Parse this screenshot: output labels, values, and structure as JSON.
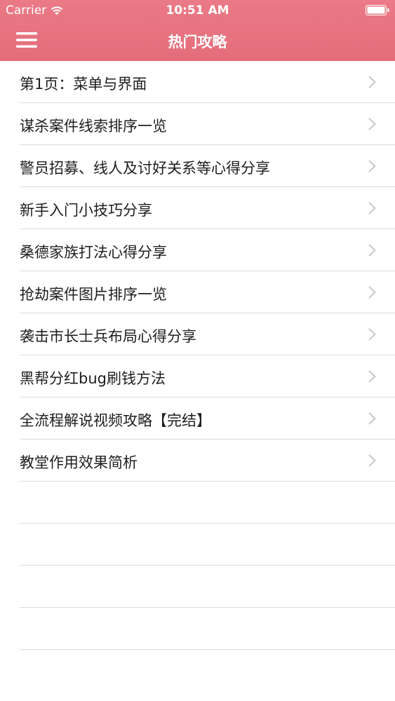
{
  "statusbar": {
    "carrier": "Carrier",
    "time": "10:51 AM"
  },
  "navbar": {
    "title": "热门攻略",
    "menu_icon": "hamburger-menu-icon",
    "background_color": "#e8737f"
  },
  "list": {
    "items": [
      {
        "label": "第1页：菜单与界面"
      },
      {
        "label": "谋杀案件线索排序一览"
      },
      {
        "label": "警员招募、线人及讨好关系等心得分享"
      },
      {
        "label": "新手入门小技巧分享"
      },
      {
        "label": "桑德家族打法心得分享"
      },
      {
        "label": "抢劫案件图片排序一览"
      },
      {
        "label": "袭击市长士兵布局心得分享"
      },
      {
        "label": "黑帮分红bug刷钱方法"
      },
      {
        "label": "全流程解说视频攻略【完结】"
      },
      {
        "label": "教堂作用效果简析"
      }
    ],
    "chevron_icon": "chevron-right-icon"
  }
}
